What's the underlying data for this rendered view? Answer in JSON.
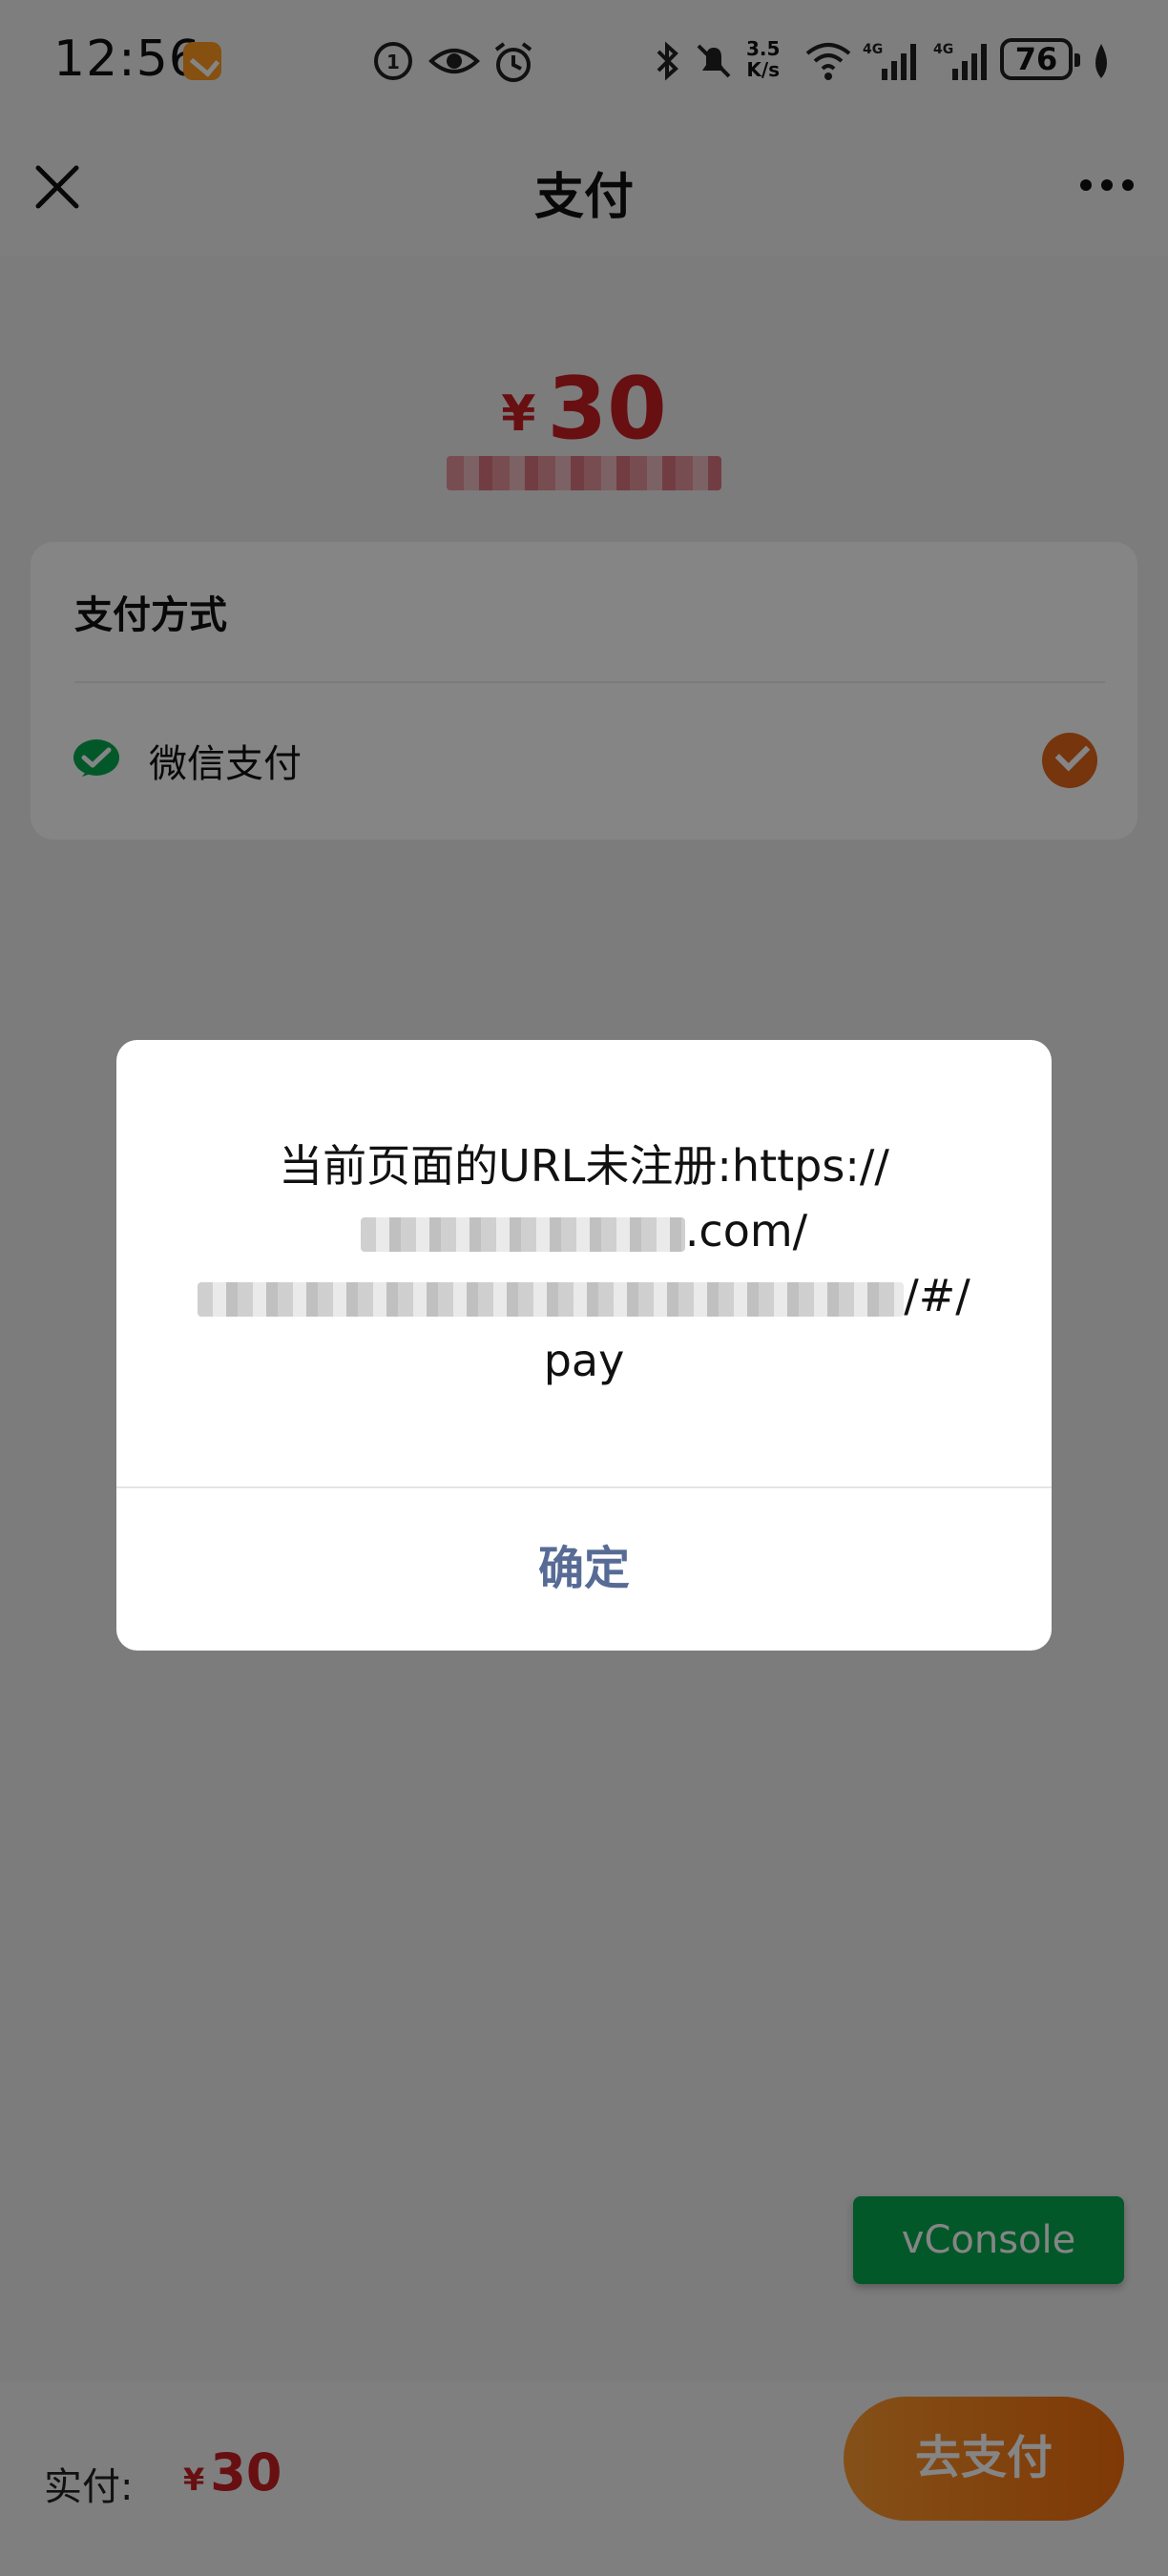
{
  "status_bar": {
    "time": "12:56",
    "network_speed_value": "3.5",
    "network_speed_unit": "K/s",
    "network_type_1": "4G",
    "network_type_2": "4G",
    "battery": "76"
  },
  "nav": {
    "title": "支付"
  },
  "amount": {
    "currency": "¥",
    "value": "30"
  },
  "payment_method": {
    "section_title": "支付方式",
    "method_label": "微信支付",
    "selected": true
  },
  "vconsole": {
    "label": "vConsole"
  },
  "bottom_bar": {
    "paid_label": "实付:",
    "currency": "¥",
    "paid_value": "30",
    "pay_button_label": "去支付"
  },
  "dialog": {
    "line1": "当前页面的URL未注册:https://",
    "line2_suffix": ".com/",
    "line3_suffix": "/#/",
    "line4": "pay",
    "confirm_label": "确定"
  },
  "colors": {
    "accent_red": "#c81d23",
    "pay_orange": "#f36d0c",
    "wechat_green": "#07a951",
    "dialog_button_blue": "#576b95"
  }
}
